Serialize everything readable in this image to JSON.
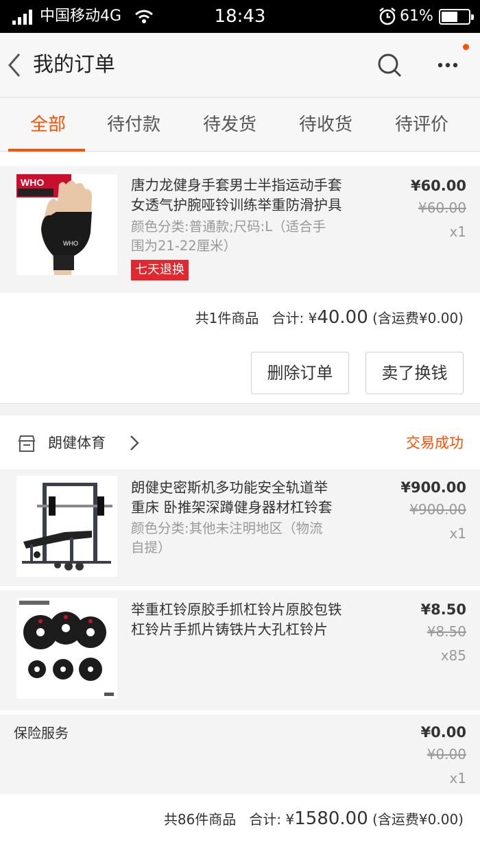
{
  "status_bar": {
    "carrier": "中国移动4G",
    "time": "18:43",
    "battery_percent": "61%",
    "battery_level": 0.61
  },
  "nav": {
    "title": "我的订单",
    "icons": [
      "back-arrow-icon",
      "search-icon",
      "more-icon"
    ],
    "notification_dot_color": "#ff5000"
  },
  "tabs": [
    {
      "label": "全部",
      "active": true
    },
    {
      "label": "待付款",
      "active": false
    },
    {
      "label": "待发货",
      "active": false
    },
    {
      "label": "待收货",
      "active": false
    },
    {
      "label": "待评价",
      "active": false
    }
  ],
  "accent_color": "#ff5000",
  "order1": {
    "item": {
      "name_line1": "唐力龙健身手套男士半指运动手套",
      "name_line2": "女透气护腕哑铃训练举重防滑护具",
      "spec_line1": "颜色分类:普通款;尺码:L（适合手",
      "spec_line2": "围为21-22厘米）",
      "badge": "七天退换",
      "price": "¥60.00",
      "orig_price": "¥60.00",
      "qty": "x1",
      "thumb_logo_text": "WHO"
    },
    "summary": {
      "count": "共1件商品",
      "total_label": "合计:",
      "currency": "¥",
      "total": "40.00",
      "shipping": "(含运费¥0.00)"
    },
    "buttons": {
      "delete": "删除订单",
      "sell": "卖了换钱"
    }
  },
  "order2": {
    "shop_name": "朗健体育",
    "status": "交易成功",
    "items": [
      {
        "name_line1": "朗健史密斯机多功能安全轨道举",
        "name_line2": "重床 卧推架深蹲健身器材杠铃套",
        "spec_line1": "颜色分类:其他未注明地区（物流",
        "spec_line2": "自提）",
        "price": "¥900.00",
        "orig_price": "¥900.00",
        "qty": "x1"
      },
      {
        "name_line1": "举重杠铃原胶手抓杠铃片原胶包铁",
        "name_line2": "杠铃片手抓片铸铁片大孔杠铃片",
        "price": "¥8.50",
        "orig_price": "¥8.50",
        "qty": "x85"
      }
    ],
    "insurance": {
      "label": "保险服务",
      "price": "¥0.00",
      "orig_price": "¥0.00",
      "qty": "x1"
    },
    "summary": {
      "count": "共86件商品",
      "total_label": "合计:",
      "currency": "¥",
      "total": "1580.00",
      "shipping": "(含运费¥0.00)"
    }
  }
}
